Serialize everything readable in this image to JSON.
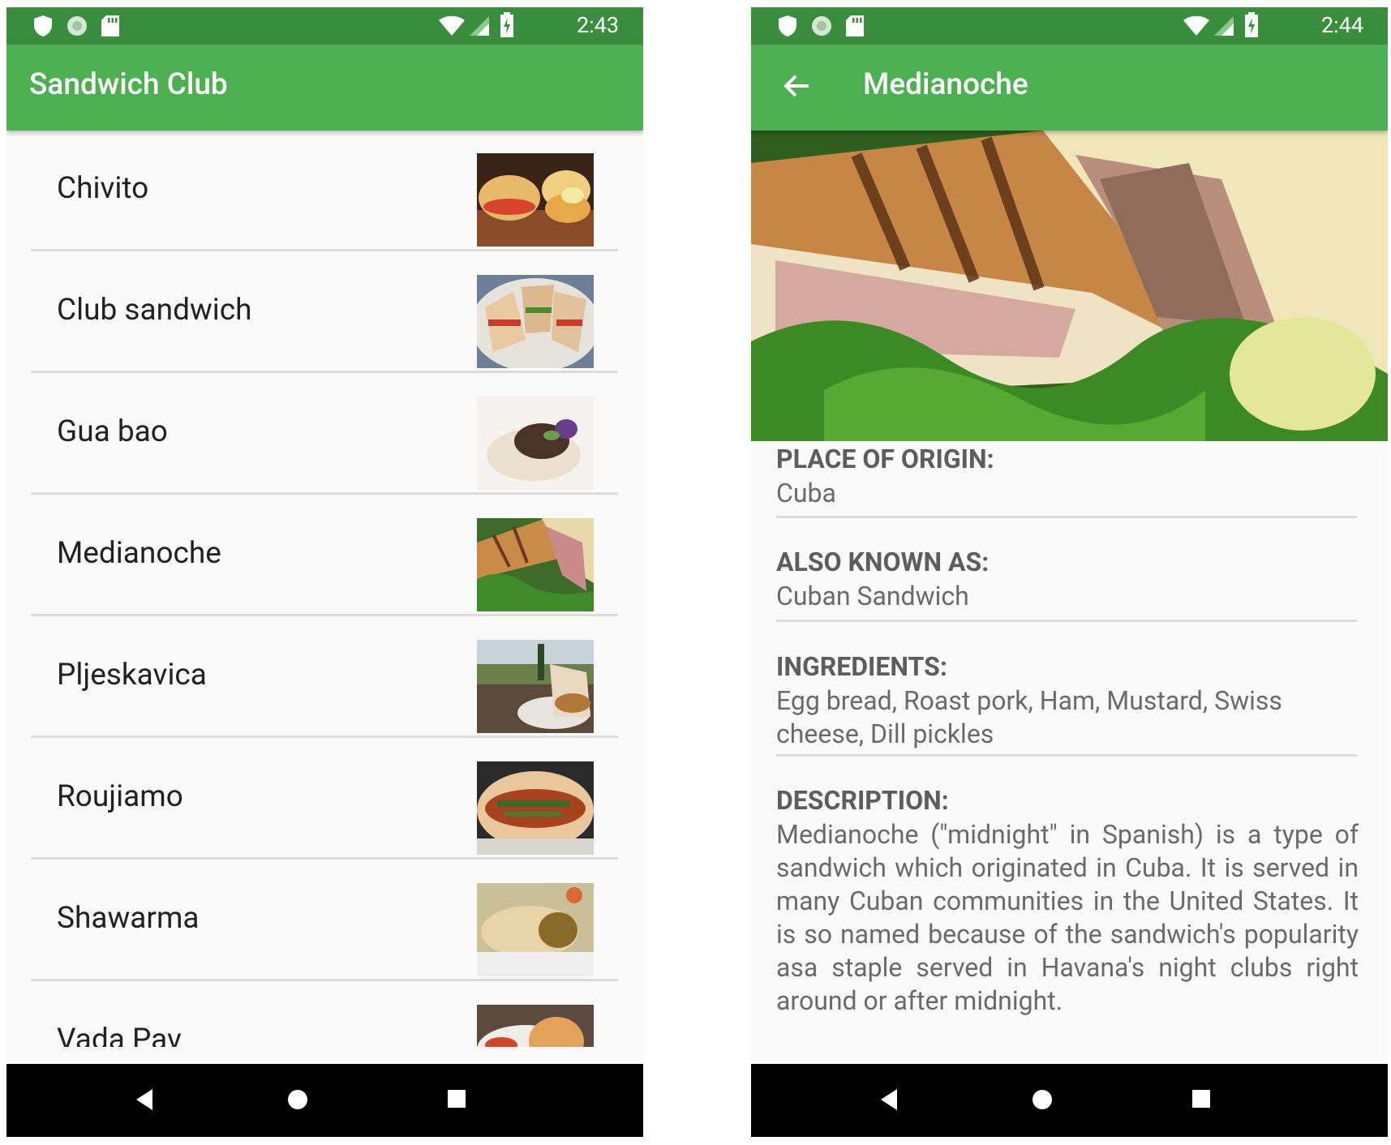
{
  "left_screen": {
    "status": {
      "time": "2:43"
    },
    "app_title": "Sandwich Club",
    "items": [
      {
        "name": "Chivito"
      },
      {
        "name": "Club sandwich"
      },
      {
        "name": "Gua bao"
      },
      {
        "name": "Medianoche"
      },
      {
        "name": "Pljeskavica"
      },
      {
        "name": "Roujiamo"
      },
      {
        "name": "Shawarma"
      },
      {
        "name": "Vada Pav"
      }
    ]
  },
  "right_screen": {
    "status": {
      "time": "2:44"
    },
    "title": "Medianoche",
    "sections": {
      "origin": {
        "label": "PLACE OF ORIGIN:",
        "value": "Cuba"
      },
      "aka": {
        "label": "ALSO KNOWN AS:",
        "value": "Cuban Sandwich"
      },
      "ingredients": {
        "label": "INGREDIENTS:",
        "value": "Egg bread, Roast pork, Ham, Mustard, Swiss cheese, Dill pickles"
      },
      "description": {
        "label": "DESCRIPTION:",
        "value": "Medianoche (\"midnight\" in Spanish) is a type of sandwich which originated in Cuba. It is served in many Cuban communities in the United States. It is so named because of the sandwich's popularity asa staple served in Havana's night clubs right around or after midnight."
      }
    }
  },
  "colors": {
    "status_bar": "#388e3c",
    "app_bar": "#4caf50",
    "background": "#fafafa",
    "divider": "#dddddd",
    "nav_bar": "#000000"
  },
  "icons": {
    "status_left": [
      "shield-icon",
      "sync-icon",
      "sd-card-icon"
    ],
    "status_right": [
      "wifi-icon",
      "signal-icon",
      "battery-charging-icon"
    ],
    "nav": [
      "back-triangle-icon",
      "home-circle-icon",
      "recents-square-icon"
    ],
    "toolbar": [
      "arrow-back-icon"
    ]
  }
}
